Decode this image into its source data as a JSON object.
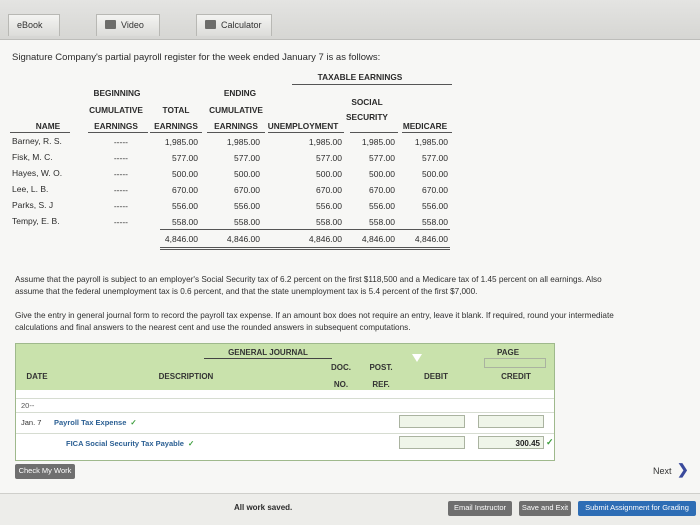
{
  "tabs": [
    {
      "label": "eBook"
    },
    {
      "label": "Video"
    },
    {
      "label": "Calculator"
    }
  ],
  "intro": "Signature Company's partial payroll register for the week ended January 7 is as follows:",
  "register": {
    "taxable_title": "TAXABLE EARNINGS",
    "headers": {
      "name": "NAME",
      "beginning": [
        "BEGINNING",
        "CUMULATIVE",
        "EARNINGS"
      ],
      "total": [
        "TOTAL",
        "EARNINGS"
      ],
      "ending": [
        "ENDING",
        "CUMULATIVE",
        "EARNINGS"
      ],
      "unemployment": "UNEMPLOYMENT",
      "social": [
        "SOCIAL",
        "SECURITY"
      ],
      "medicare": "MEDICARE"
    },
    "rows": [
      {
        "name": "Barney, R. S.",
        "beg": "-----",
        "total": "1,985.00",
        "end": "1,985.00",
        "unemp": "1,985.00",
        "ss": "1,985.00",
        "med": "1,985.00"
      },
      {
        "name": "Fisk, M. C.",
        "beg": "-----",
        "total": "577.00",
        "end": "577.00",
        "unemp": "577.00",
        "ss": "577.00",
        "med": "577.00"
      },
      {
        "name": "Hayes, W. O.",
        "beg": "-----",
        "total": "500.00",
        "end": "500.00",
        "unemp": "500.00",
        "ss": "500.00",
        "med": "500.00"
      },
      {
        "name": "Lee, L. B.",
        "beg": "-----",
        "total": "670.00",
        "end": "670.00",
        "unemp": "670.00",
        "ss": "670.00",
        "med": "670.00"
      },
      {
        "name": "Parks, S. J",
        "beg": "-----",
        "total": "556.00",
        "end": "556.00",
        "unemp": "556.00",
        "ss": "556.00",
        "med": "556.00"
      },
      {
        "name": "Tempy, E. B.",
        "beg": "-----",
        "total": "558.00",
        "end": "558.00",
        "unemp": "558.00",
        "ss": "558.00",
        "med": "558.00"
      }
    ],
    "totals": {
      "total": "4,846.00",
      "end": "4,846.00",
      "unemp": "4,846.00",
      "ss": "4,846.00",
      "med": "4,846.00"
    }
  },
  "assumption_lines": [
    "Assume that the payroll is subject to an employer's Social Security tax of 6.2 percent on the first $118,500 and a Medicare tax of 1.45 percent on all earnings. Also",
    "assume that the federal unemployment tax is 0.6 percent, and that the state unemployment tax is 5.4 percent of the first $7,000."
  ],
  "instruction_lines": [
    "Give the entry in general journal form to record the payroll tax expense. If an amount box does not require an entry, leave it blank. If required, round your intermediate",
    "calculations and final answers to the nearest cent and use the rounded answers in subsequent computations."
  ],
  "journal": {
    "title": "GENERAL JOURNAL",
    "page_label": "PAGE",
    "columns": {
      "date": "DATE",
      "description": "DESCRIPTION",
      "doc": [
        "DOC.",
        "NO."
      ],
      "post": [
        "POST.",
        "REF."
      ],
      "debit": "DEBIT",
      "credit": "CREDIT"
    },
    "year": "20--",
    "date": "Jan. 7",
    "line1": "Payroll Tax Expense",
    "line2": "FICA Social Security Tax Payable",
    "credit_value": "300.45"
  },
  "buttons": {
    "check": "Check My Work",
    "next": "Next",
    "email": "Email Instructor",
    "save": "Save and Exit",
    "submit": "Submit Assignment for Grading"
  },
  "status": "All work saved.",
  "colors": {
    "journal_header": "#c9e2ac",
    "link_blue": "#2b5f93",
    "check_green": "#3a9c3a",
    "button_gray": "#6f6f6f",
    "submit_blue": "#2d6db5"
  }
}
